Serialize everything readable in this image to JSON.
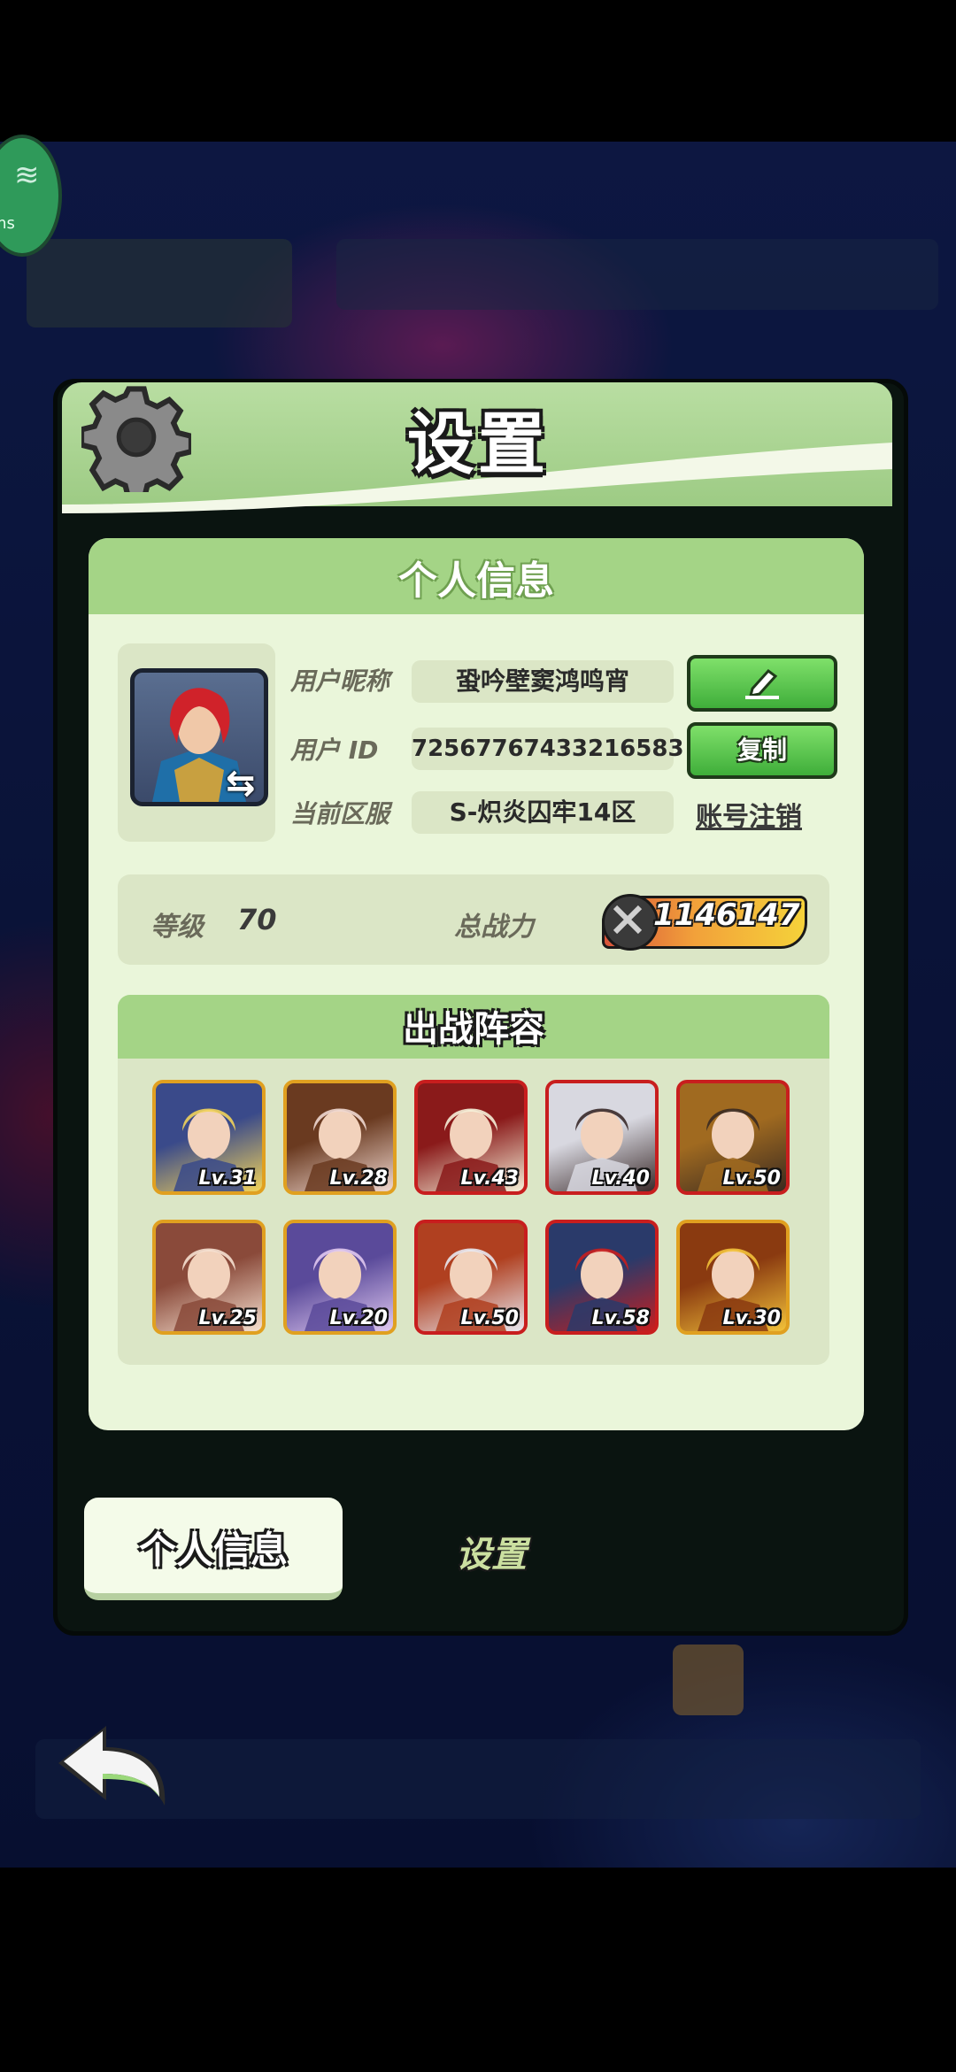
{
  "network": {
    "label": "ms"
  },
  "header": {
    "title": "设置"
  },
  "profile": {
    "section_title": "个人信息",
    "nickname_label": "用户昵称",
    "nickname_value": "蛩吟壁窦鸿鸣宵",
    "id_label": "用户 ID",
    "id_value": "72567767433216583",
    "server_label": "当前区服",
    "server_value": "S-炽炎囚牢14区",
    "copy_button": "复制",
    "account_cancel_link": "账号注销"
  },
  "stats": {
    "level_label": "等级",
    "level_value": "70",
    "power_label": "总战力",
    "power_value": "1146147"
  },
  "lineup": {
    "title": "出战阵容",
    "heroes": [
      {
        "level": "Lv.31",
        "frame": "gold",
        "colors": [
          "#3a4a8a",
          "#f2d35a"
        ]
      },
      {
        "level": "Lv.28",
        "frame": "gold",
        "colors": [
          "#6a3a20",
          "#f0d8d0"
        ]
      },
      {
        "level": "Lv.43",
        "frame": "red",
        "colors": [
          "#8a1a1a",
          "#f5f0d8"
        ]
      },
      {
        "level": "Lv.40",
        "frame": "red",
        "colors": [
          "#d8d8e0",
          "#3a2a2a"
        ]
      },
      {
        "level": "Lv.50",
        "frame": "red",
        "colors": [
          "#a06a20",
          "#3a2a20"
        ]
      },
      {
        "level": "Lv.25",
        "frame": "gold",
        "colors": [
          "#8a4a3a",
          "#f5e0d0"
        ]
      },
      {
        "level": "Lv.20",
        "frame": "gold",
        "colors": [
          "#5a4a9a",
          "#e0c8f0"
        ]
      },
      {
        "level": "Lv.50",
        "frame": "red",
        "colors": [
          "#b04020",
          "#e8e8f0"
        ]
      },
      {
        "level": "Lv.58",
        "frame": "red",
        "colors": [
          "#2a3a6a",
          "#c81e1e"
        ]
      },
      {
        "level": "Lv.30",
        "frame": "gold",
        "colors": [
          "#8a3a10",
          "#f2c23a"
        ]
      }
    ]
  },
  "tabs": {
    "active": "个人信息",
    "inactive": "设置"
  },
  "colors": {
    "header_green": "#9dcb84",
    "card_bg": "#eaf6da",
    "button_green": "#3fae3a"
  }
}
